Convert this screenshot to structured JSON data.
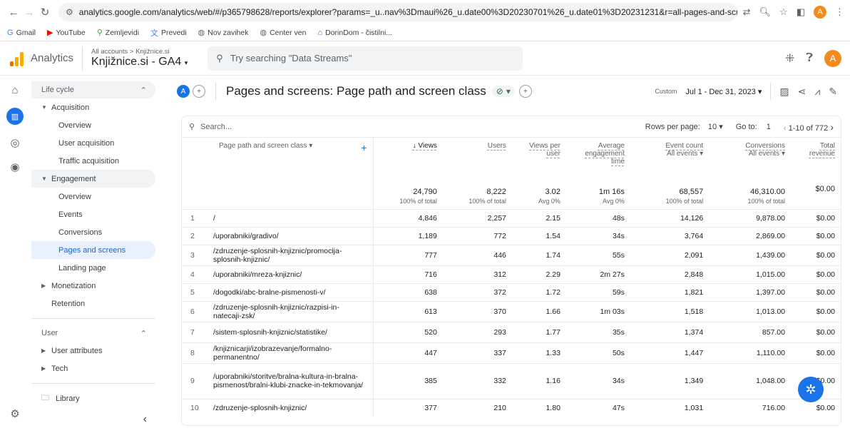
{
  "browser": {
    "url": "analytics.google.com/analytics/web/#/p365798628/reports/explorer?params=_u..nav%3Dmaui%26_u.date00%3D20230701%26_u.date01%3D20231231&r=all-pages-and-screens&ruid=...",
    "profile_initial": "A"
  },
  "bookmarks": [
    {
      "label": "Gmail",
      "icon": "google-g-icon"
    },
    {
      "label": "YouTube",
      "icon": "youtube-icon"
    },
    {
      "label": "Zemljevidi",
      "icon": "maps-pin-icon"
    },
    {
      "label": "Prevedi",
      "icon": "translate-icon"
    },
    {
      "label": "Nov zavihek",
      "icon": "globe-icon"
    },
    {
      "label": "Center ven",
      "icon": "globe-icon"
    },
    {
      "label": "DorinDom - čistilni...",
      "icon": "house-icon"
    }
  ],
  "header": {
    "app_name": "Analytics",
    "account_path": "All accounts > Knjižnice.si",
    "property": "Knjižnice.si - GA4",
    "search_placeholder": "Try searching \"Data Streams\"",
    "user_initial": "A"
  },
  "sidebar": {
    "lifecycle_label": "Life cycle",
    "acquisition_label": "Acquisition",
    "acquisition_items": [
      "Overview",
      "User acquisition",
      "Traffic acquisition"
    ],
    "engagement_label": "Engagement",
    "engagement_items": [
      "Overview",
      "Events",
      "Conversions",
      "Pages and screens",
      "Landing page"
    ],
    "monetization_label": "Monetization",
    "retention_label": "Retention",
    "user_label": "User",
    "user_attributes_label": "User attributes",
    "tech_label": "Tech",
    "library_label": "Library"
  },
  "toolbar": {
    "segment_initial": "A",
    "title": "Pages and screens: Page path and screen class",
    "date_prefix": "Custom",
    "date_range": "Jul 1 - Dec 31, 2023"
  },
  "table": {
    "search_placeholder": "Search...",
    "rows_per_page_label": "Rows per page:",
    "rows_per_page": "10",
    "goto_label": "Go to:",
    "goto_value": "1",
    "range": "1-10 of 772",
    "dimension_header": "Page path and screen class",
    "headers": {
      "views": "↓ Views",
      "users": "Users",
      "views_per_user": "Views per user",
      "avg_engagement": "Average engagement time",
      "event_count": "Event count",
      "event_count_sub": "All events",
      "conversions": "Conversions",
      "conversions_sub": "All events",
      "total_revenue": "Total revenue"
    },
    "totals": {
      "views": "24,790",
      "views_sub": "100% of total",
      "users": "8,222",
      "users_sub": "100% of total",
      "views_per_user": "3.02",
      "views_per_user_sub": "Avg 0%",
      "avg_engagement": "1m 16s",
      "avg_engagement_sub": "Avg 0%",
      "event_count": "68,557",
      "event_count_sub": "100% of total",
      "conversions": "46,310.00",
      "conversions_sub": "100% of total",
      "total_revenue": "$0.00"
    },
    "rows": [
      {
        "idx": "1",
        "path": "/",
        "views": "4,846",
        "users": "2,257",
        "vpu": "2.15",
        "aet": "48s",
        "events": "14,126",
        "conv": "9,878.00",
        "rev": "$0.00"
      },
      {
        "idx": "2",
        "path": "/uporabniki/gradivo/",
        "views": "1,189",
        "users": "772",
        "vpu": "1.54",
        "aet": "34s",
        "events": "3,764",
        "conv": "2,869.00",
        "rev": "$0.00"
      },
      {
        "idx": "3",
        "path": "/zdruzenje-splosnih-knjiznic/promocija-splosnih-knjiznic/",
        "views": "777",
        "users": "446",
        "vpu": "1.74",
        "aet": "55s",
        "events": "2,091",
        "conv": "1,439.00",
        "rev": "$0.00"
      },
      {
        "idx": "4",
        "path": "/uporabniki/mreza-knjiznic/",
        "views": "716",
        "users": "312",
        "vpu": "2.29",
        "aet": "2m 27s",
        "events": "2,848",
        "conv": "1,015.00",
        "rev": "$0.00"
      },
      {
        "idx": "5",
        "path": "/dogodki/abc-bralne-pismenosti-v/",
        "views": "638",
        "users": "372",
        "vpu": "1.72",
        "aet": "59s",
        "events": "1,821",
        "conv": "1,397.00",
        "rev": "$0.00"
      },
      {
        "idx": "6",
        "path": "/zdruzenje-splosnih-knjiznic/razpisi-in-natecaji-zsk/",
        "views": "613",
        "users": "370",
        "vpu": "1.66",
        "aet": "1m 03s",
        "events": "1,518",
        "conv": "1,013.00",
        "rev": "$0.00"
      },
      {
        "idx": "7",
        "path": "/sistem-splosnih-knjiznic/statistike/",
        "views": "520",
        "users": "293",
        "vpu": "1.77",
        "aet": "35s",
        "events": "1,374",
        "conv": "857.00",
        "rev": "$0.00"
      },
      {
        "idx": "8",
        "path": "/knjiznicarji/izobrazevanje/formalno-permanentno/",
        "views": "447",
        "users": "337",
        "vpu": "1.33",
        "aet": "50s",
        "events": "1,447",
        "conv": "1,110.00",
        "rev": "$0.00"
      },
      {
        "idx": "9",
        "path": "/uporabniki/storitve/bralna-kultura-in-bralna-pismenost/bralni-klubi-znacke-in-tekmovanja/",
        "views": "385",
        "users": "332",
        "vpu": "1.16",
        "aet": "34s",
        "events": "1,349",
        "conv": "1,048.00",
        "rev": "$0.00"
      },
      {
        "idx": "10",
        "path": "/zdruzenje-splosnih-knjiznic/",
        "views": "377",
        "users": "210",
        "vpu": "1.80",
        "aet": "47s",
        "events": "1,031",
        "conv": "716.00",
        "rev": "$0.00"
      }
    ]
  },
  "colors": {
    "accent": "#1a73e8",
    "logo_orange": "#f9ab00",
    "logo_dark": "#e37400"
  }
}
